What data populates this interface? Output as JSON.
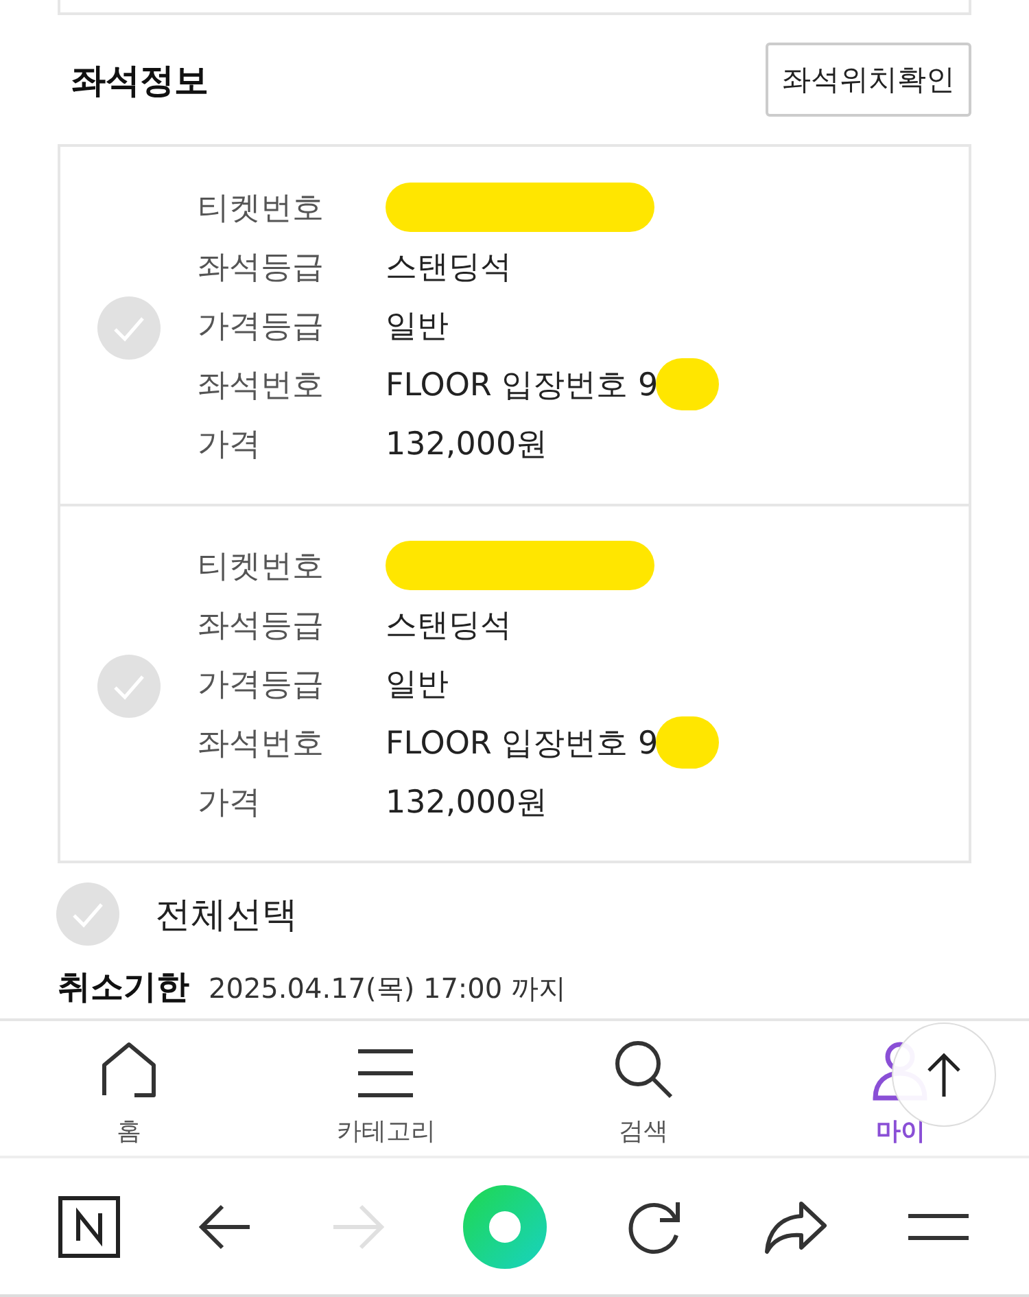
{
  "section": {
    "title": "좌석정보",
    "action": "좌석위치확인"
  },
  "tickets": [
    {
      "checked": false,
      "fields": [
        {
          "label": "티켓번호",
          "redacted": true
        },
        {
          "label": "좌석등급",
          "value": "스탠딩석",
          "redacted": false
        },
        {
          "label": "가격등급",
          "value": "일반",
          "redacted": false
        },
        {
          "label": "좌석번호",
          "value": "FLOOR 입장번호 9",
          "redacted": true
        },
        {
          "label": "가격",
          "value": "132,000원",
          "redacted": false
        }
      ]
    },
    {
      "checked": false,
      "fields": [
        {
          "label": "티켓번호",
          "redacted": true
        },
        {
          "label": "좌석등급",
          "value": "스탠딩석",
          "redacted": false
        },
        {
          "label": "가격등급",
          "value": "일반",
          "redacted": false
        },
        {
          "label": "좌석번호",
          "value": "FLOOR 입장번호 9",
          "redacted": true
        },
        {
          "label": "가격",
          "value": "132,000원",
          "redacted": false
        }
      ]
    }
  ],
  "select_all": {
    "label": "전체선택",
    "checked": false
  },
  "cancel_deadline": {
    "label": "취소기한",
    "value": "2025.04.17(목) 17:00 까지"
  },
  "tab_bar": [
    {
      "kind": "home",
      "label": "홈",
      "selected": false
    },
    {
      "kind": "category",
      "label": "카테고리",
      "selected": false
    },
    {
      "kind": "search",
      "label": "검색",
      "selected": false
    },
    {
      "kind": "my",
      "label": "마이",
      "selected": true
    }
  ],
  "browser_bar": [
    {
      "kind": "naver",
      "disabled": false
    },
    {
      "kind": "back",
      "disabled": false
    },
    {
      "kind": "forward",
      "disabled": true
    },
    {
      "kind": "home",
      "disabled": false
    },
    {
      "kind": "reload",
      "disabled": false
    },
    {
      "kind": "share",
      "disabled": false
    },
    {
      "kind": "menu",
      "disabled": false
    }
  ]
}
